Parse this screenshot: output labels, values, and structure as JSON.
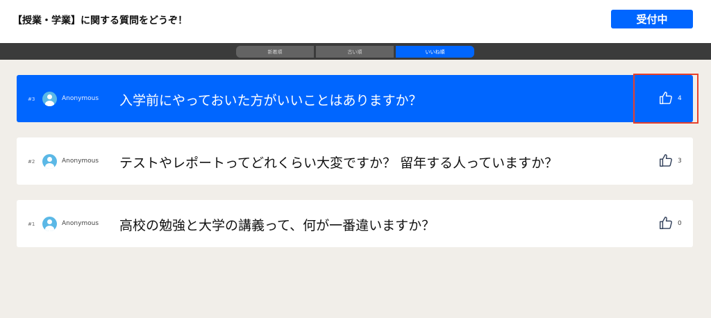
{
  "header": {
    "title": "【授業・学業】に関する質問をどうぞ！",
    "status_label": "受付中"
  },
  "tabs": [
    {
      "label": "新着順",
      "active": false
    },
    {
      "label": "古い順",
      "active": false
    },
    {
      "label": "いいね順",
      "active": true
    }
  ],
  "questions": [
    {
      "number": "#3",
      "author": "Anonymous",
      "text": "入学前にやっておいた方がいいことはありますか？",
      "likes": "4",
      "highlighted": true
    },
    {
      "number": "#2",
      "author": "Anonymous",
      "text": "テストやレポートってどれくらい大変ですか？ 留年する人っていますか？",
      "likes": "3",
      "highlighted": false
    },
    {
      "number": "#1",
      "author": "Anonymous",
      "text": "高校の勉強と大学の講義って、何が一番違いますか？",
      "likes": "0",
      "highlighted": false
    }
  ],
  "icons": {
    "like": "thumbs-up-icon",
    "avatar": "user-avatar-icon"
  },
  "colors": {
    "accent": "#0066ff",
    "highlight_box": "#e8402a",
    "background": "#f1eee9"
  }
}
